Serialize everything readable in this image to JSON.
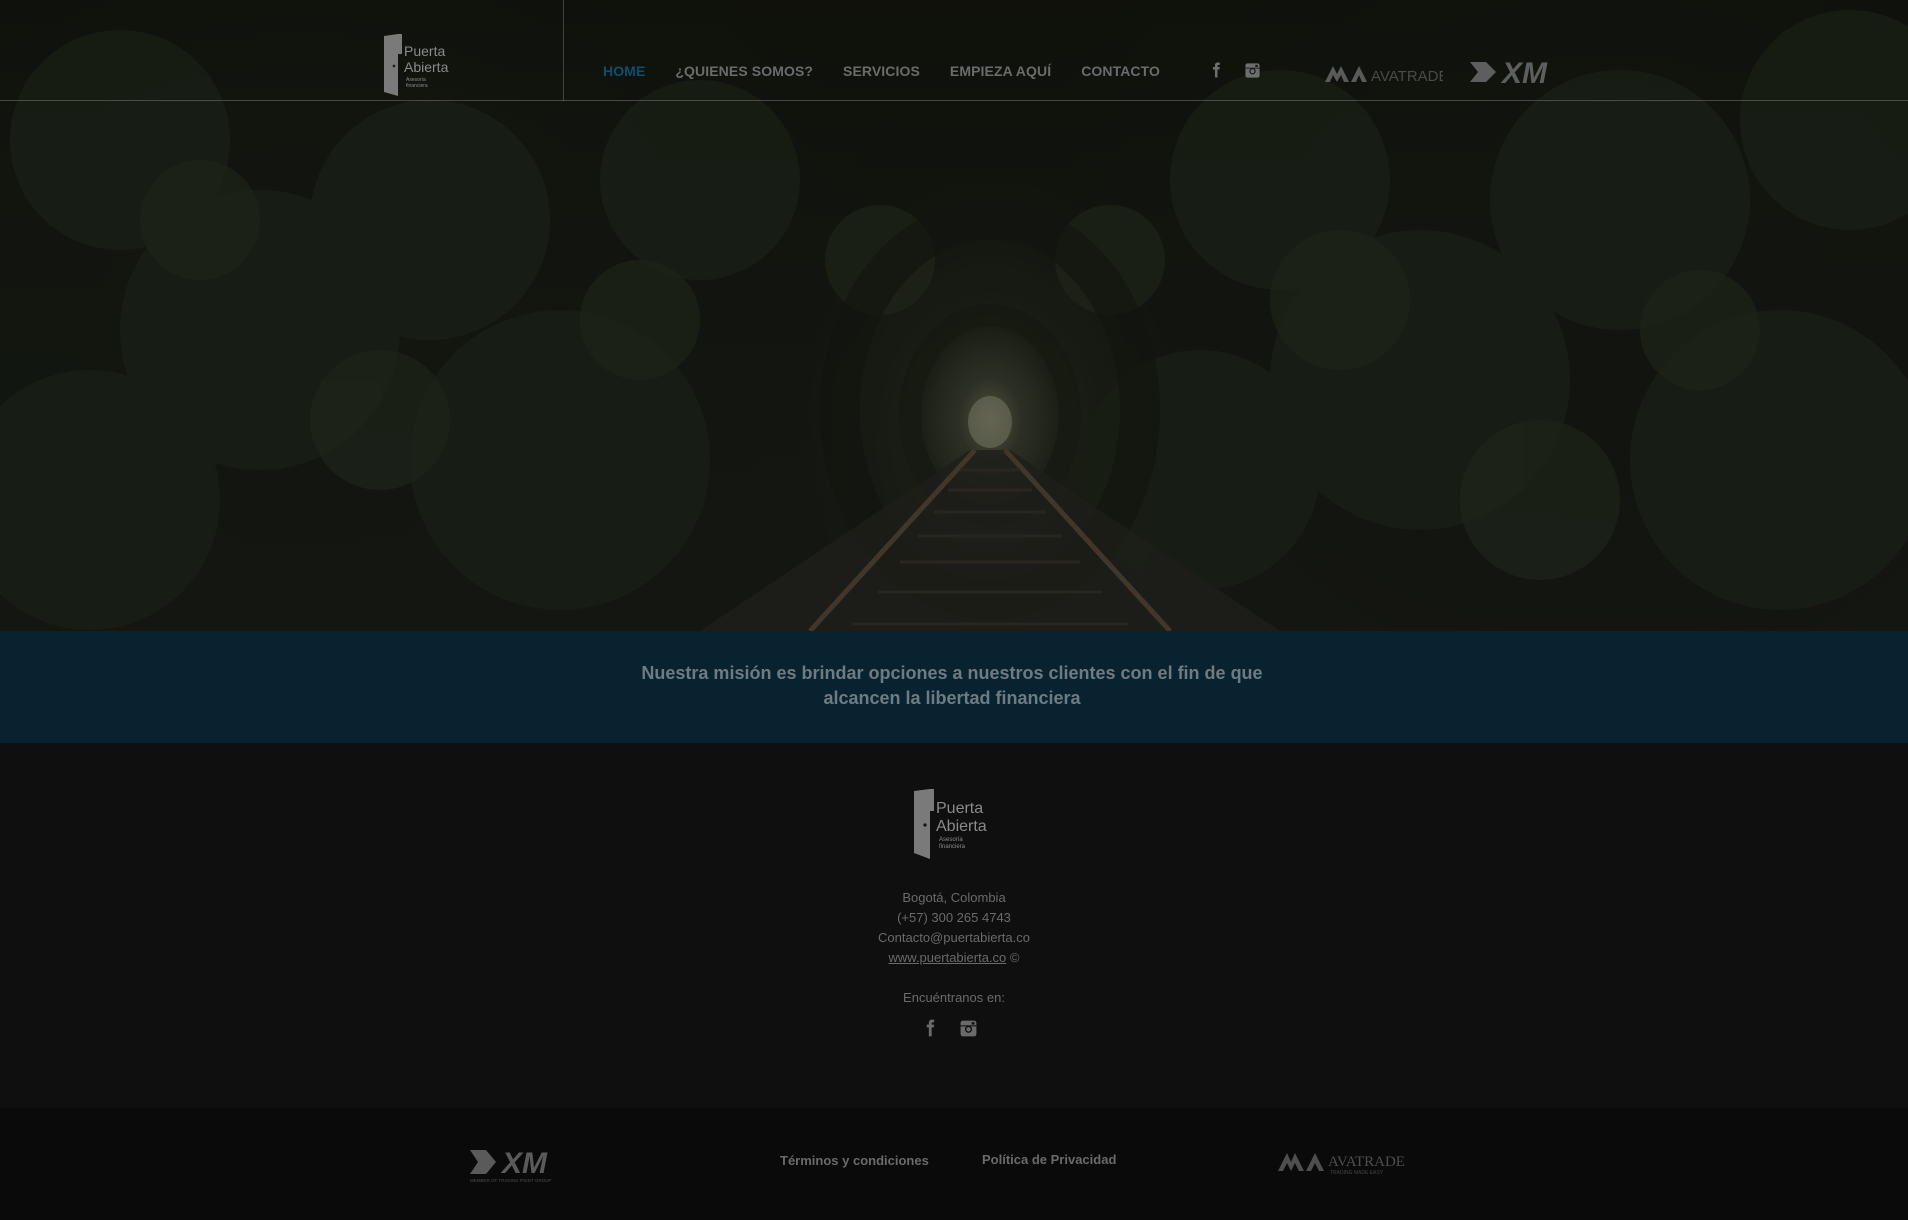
{
  "header": {
    "logo_text": {
      "line1": "Puerta",
      "line2": "Abierta",
      "line3": "Asesoría",
      "line4": "financiera"
    },
    "nav": [
      {
        "label": "HOME",
        "active": true
      },
      {
        "label": "¿QUIENES SOMOS?",
        "active": false
      },
      {
        "label": "SERVICIOS",
        "active": false
      },
      {
        "label": "EMPIEZA AQUÍ",
        "active": false
      },
      {
        "label": "CONTACTO",
        "active": false
      }
    ],
    "social_icons": [
      "facebook-icon",
      "instagram-icon"
    ],
    "partners": [
      {
        "name": "AVATRADE",
        "wordmark": "AVATRADE"
      },
      {
        "name": "XM",
        "wordmark": "XM"
      }
    ]
  },
  "mission": {
    "text": "Nuestra misión es brindar opciones a nuestros clientes con el fin de que alcancen la libertad financiera"
  },
  "footer": {
    "logo_text": {
      "line1": "Puerta",
      "line2": "Abierta",
      "line3": "Asesoría",
      "line4": "financiera"
    },
    "city": "Bogotá, Colombia",
    "phone": "(+57) 300 265 4743",
    "email": "Contacto@puertabierta.co",
    "website": "www.puertabierta.co",
    "copyright": " ©",
    "find_us": "Encuéntranos en:",
    "social_icons": [
      "facebook-icon",
      "instagram-icon"
    ]
  },
  "bottom": {
    "terms": "Términos y condiciones",
    "privacy": "Política de Privacidad",
    "xm_wordmark": "XM",
    "xm_tagline": "MEMBER OF TRADING POINT GROUP",
    "ava_wordmark": "AVATRADE",
    "ava_tagline": "TRADING MADE EASY"
  },
  "colors": {
    "nav_active": "#0b4f73",
    "nav_text": "#6b6b6b",
    "mission_bg": "#082230",
    "footer_bg": "#0f0f0f",
    "bottom_bg": "#0a0a0a"
  }
}
